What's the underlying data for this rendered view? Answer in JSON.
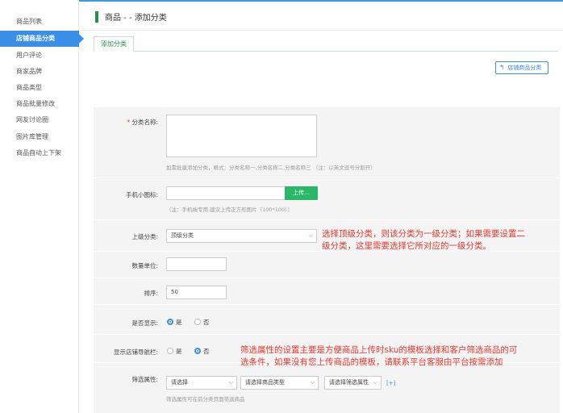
{
  "sidebar": {
    "items": [
      {
        "label": "商品列表",
        "active": false
      },
      {
        "label": "店铺商品分类",
        "active": true
      },
      {
        "label": "用户评论",
        "active": false
      },
      {
        "label": "商家品牌",
        "active": false
      },
      {
        "label": "商品类型",
        "active": false
      },
      {
        "label": "商品批量修改",
        "active": false
      },
      {
        "label": "网友讨论圈",
        "active": false
      },
      {
        "label": "图片库管理",
        "active": false
      },
      {
        "label": "商品自动上下架",
        "active": false
      }
    ]
  },
  "header": {
    "title": "商品 - - 添加分类"
  },
  "tabs": [
    {
      "label": "添加分类",
      "active": true
    }
  ],
  "actions": {
    "back_label": "店铺商品分类"
  },
  "form": {
    "category_name": {
      "label": "分类名称:",
      "required_mark": "*",
      "value": "",
      "hint": "如需批量添加分类，格式：分类名称一,分类名称二,分类名称三 （注：以英文逗号分割开）"
    },
    "mobile_icon": {
      "label": "手机小图标:",
      "upload_label": "上传...",
      "hint": "（注：手机端专用,建议上传正方形图片（100*100））"
    },
    "parent_category": {
      "label": "上级分类:",
      "value": "顶级分类"
    },
    "unit": {
      "label": "数量单位:",
      "value": ""
    },
    "sort": {
      "label": "排序:",
      "value": "50"
    },
    "is_show": {
      "label": "是否显示:",
      "options": [
        {
          "label": "是",
          "checked": true
        },
        {
          "label": "否",
          "checked": false
        }
      ]
    },
    "show_in_nav": {
      "label": "显示店铺导航栏:",
      "options": [
        {
          "label": "是",
          "checked": false
        },
        {
          "label": "否",
          "checked": true
        }
      ]
    },
    "filter_attr": {
      "label": "筛选属性:",
      "selects": [
        "请选择",
        "请选择商品类型",
        "请选择筛选属性"
      ],
      "add_label": "[+]",
      "hint": "筛选属性可在前分类页面筛选商品"
    }
  },
  "annotations": {
    "parent_note": {
      "lines": [
        "选择顶级分类，则该分类为一级分类；如果需要设置二",
        "级分类，这里需要选择它所对应的一级分类。"
      ]
    },
    "filter_note": {
      "lines": [
        "筛选属性的设置主要是方便商品上传时sku的模板选择和客户筛选商品的可",
        "选条件，如果没有您上传商品的模板，请联系平台客服由平台按需添加"
      ]
    }
  },
  "colors": {
    "accent_blue": "#3a8ee6",
    "accent_green": "#2a8f4f",
    "upload_green": "#2ab76a",
    "annotation_red": "#e5382f"
  }
}
